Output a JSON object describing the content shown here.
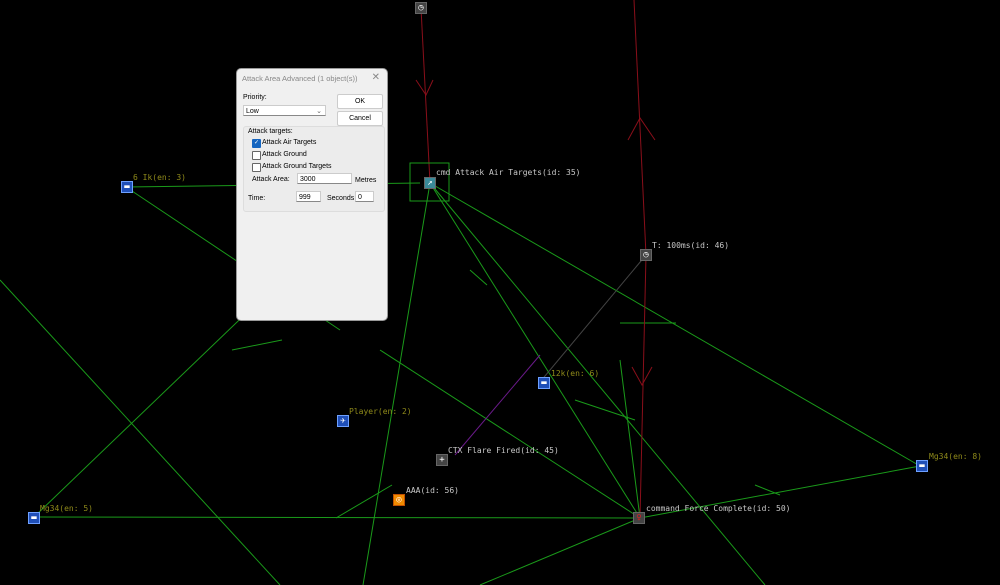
{
  "map": {
    "nodes": [
      {
        "label": "6 Ik(en: 3)",
        "type": "unit",
        "icon": "truck-icon"
      },
      {
        "label": "cmd Attack Air Targets(id: 35)",
        "type": "command",
        "icon": "attack-icon"
      },
      {
        "label": "T: 100ms(id: 46)",
        "type": "timer",
        "icon": "timer-icon"
      },
      {
        "label": "12k(en: 6)",
        "type": "unit",
        "icon": "truck-icon"
      },
      {
        "label": "Player(en: 2)",
        "type": "unit",
        "icon": "plane-icon"
      },
      {
        "label": "CTX Flare Fired(id: 45)",
        "type": "context",
        "icon": "flare-icon"
      },
      {
        "label": "AAA(id: 56)",
        "type": "unit",
        "icon": "aaa-icon"
      },
      {
        "label": "Mg34(en: 5)",
        "type": "unit",
        "icon": "truck-icon"
      },
      {
        "label": "Mg34(en: 8)",
        "type": "unit",
        "icon": "truck-icon"
      },
      {
        "label": "command Force Complete(id: 50)",
        "type": "command",
        "icon": "force-complete-icon"
      }
    ],
    "colors": {
      "link": "#1aa31a",
      "red_link": "#8a0f1a",
      "unit_label": "#8f8a1a",
      "cmd_label": "#c8c8c8"
    }
  },
  "dialog": {
    "title": "Attack Area Advanced (1 object(s))",
    "priority_label": "Priority:",
    "priority_value": "Low",
    "ok": "OK",
    "cancel": "Cancel",
    "targets_label": "Attack targets:",
    "checkboxes": [
      {
        "label": "Attack Air Targets",
        "checked": true
      },
      {
        "label": "Attack Ground",
        "checked": false
      },
      {
        "label": "Attack Ground Targets",
        "checked": false
      }
    ],
    "area_label": "Attack Area:",
    "area_value": "3000",
    "area_unit": "Metres",
    "time_label": "Time:",
    "time_value": "999",
    "time_unit": "Seconds",
    "seconds_value": "0"
  }
}
